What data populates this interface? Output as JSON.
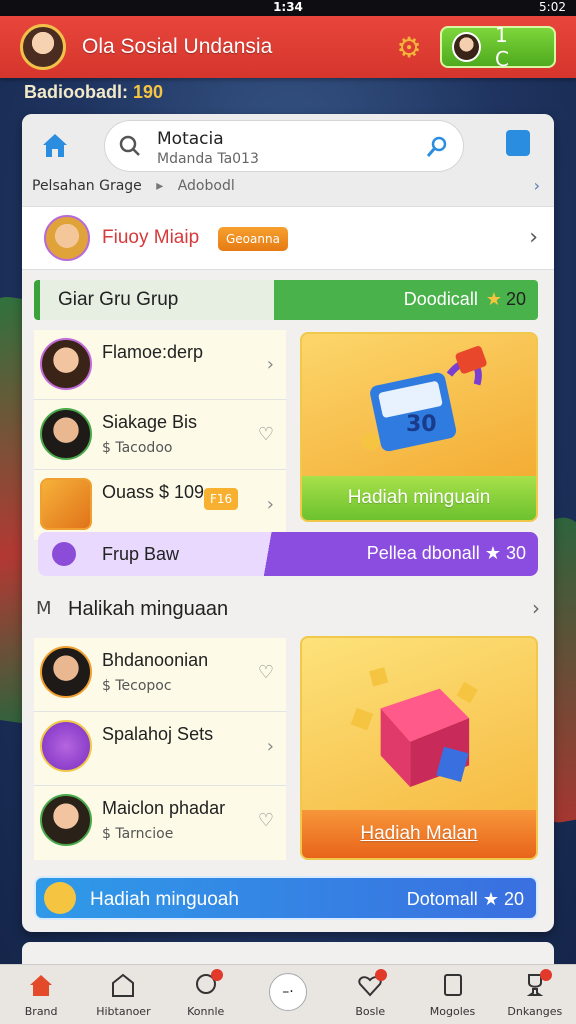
{
  "status": {
    "time": "1:34",
    "right": "5:02"
  },
  "header": {
    "title": "Ola Sosial Undansia",
    "coins": "1 C"
  },
  "badge": {
    "label": "Badioobadl:",
    "value": "190"
  },
  "topnav": {
    "search_value": "Motacia",
    "search_placeholder": "Mdanda Ta013",
    "breadcrumb": [
      "Pelsahan Grage",
      "Adobodl"
    ]
  },
  "profile": {
    "name": "Fiuoy Miaip",
    "badge": "Geoanna"
  },
  "group": {
    "title": "Giar Gru Grup",
    "right_label": "Doodicall",
    "right_value": "20"
  },
  "list1": [
    {
      "title": "Flamoe:derp",
      "sub": "",
      "right": "›"
    },
    {
      "title": "Siakage Bis",
      "sub": "$ Tacodoo",
      "right": "♡"
    },
    {
      "title": "Ouass $ 109",
      "sub": "",
      "pill": "F16",
      "right": "›"
    }
  ],
  "promo1": {
    "button": "Hadiah minguain",
    "number": "30"
  },
  "purple_banner": {
    "left": "Frup Baw",
    "right_label": "Pellea dbonall",
    "right_value": "30"
  },
  "section2": {
    "icon": "M",
    "title": "Halikah minguaan"
  },
  "list2": [
    {
      "title": "Bhdanoonian",
      "sub": "$ Tecopoc",
      "right": "♡"
    },
    {
      "title": "Spalahoj Sets",
      "sub": "",
      "right": "›"
    },
    {
      "title": "Maiclon phadar",
      "sub": "$ Tarncioe",
      "right": "♡"
    }
  ],
  "promo2": {
    "button": "Hadiah Malan"
  },
  "blue_banner": {
    "left": "Hadiah minguoah",
    "right_label": "Dotomall",
    "right_value": "20"
  },
  "bottom_nav": [
    {
      "label": "Brand",
      "icon": "home-icon"
    },
    {
      "label": "Hibtanoer",
      "icon": "shop-icon"
    },
    {
      "label": "Konnle",
      "icon": "chat-icon"
    },
    {
      "label": "",
      "icon": "center-button"
    },
    {
      "label": "Bosle",
      "icon": "heart-icon"
    },
    {
      "label": "Mogoles",
      "icon": "list-icon"
    },
    {
      "label": "Dnkanges",
      "icon": "trophy-icon"
    }
  ],
  "colors": {
    "header_red": "#e8463c",
    "accent_green": "#4faa1f",
    "accent_purple": "#8a4de0",
    "accent_blue": "#2f9ae8"
  }
}
